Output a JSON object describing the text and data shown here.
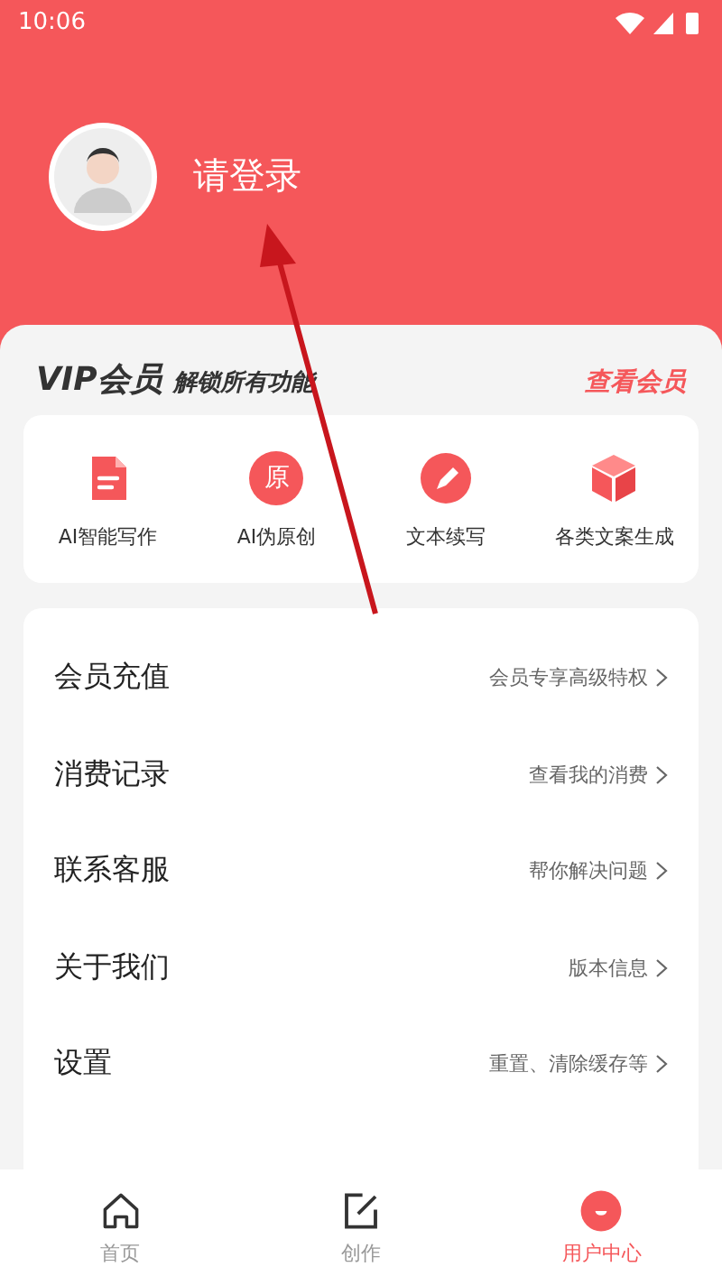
{
  "status_bar": {
    "time": "10:06"
  },
  "profile": {
    "login_prompt": "请登录"
  },
  "vip": {
    "title": "VIP会员",
    "subtitle": "解锁所有功能",
    "link": "查看会员"
  },
  "features": [
    {
      "kind": "document",
      "label": "AI智能写作"
    },
    {
      "kind": "badge",
      "badge_text": "原",
      "label": "AI伪原创"
    },
    {
      "kind": "pen",
      "label": "文本续写"
    },
    {
      "kind": "cube",
      "label": "各类文案生成"
    }
  ],
  "menu": [
    {
      "label": "会员充值",
      "detail": "会员专享高级特权"
    },
    {
      "label": "消费记录",
      "detail": "查看我的消费"
    },
    {
      "label": "联系客服",
      "detail": "帮你解决问题"
    },
    {
      "label": "关于我们",
      "detail": "版本信息"
    },
    {
      "label": "设置",
      "detail": "重置、清除缓存等"
    }
  ],
  "nav": [
    {
      "kind": "home",
      "label": "首页",
      "selected": false
    },
    {
      "kind": "edit",
      "label": "创作",
      "selected": false
    },
    {
      "kind": "user",
      "label": "用户中心",
      "selected": true
    }
  ]
}
